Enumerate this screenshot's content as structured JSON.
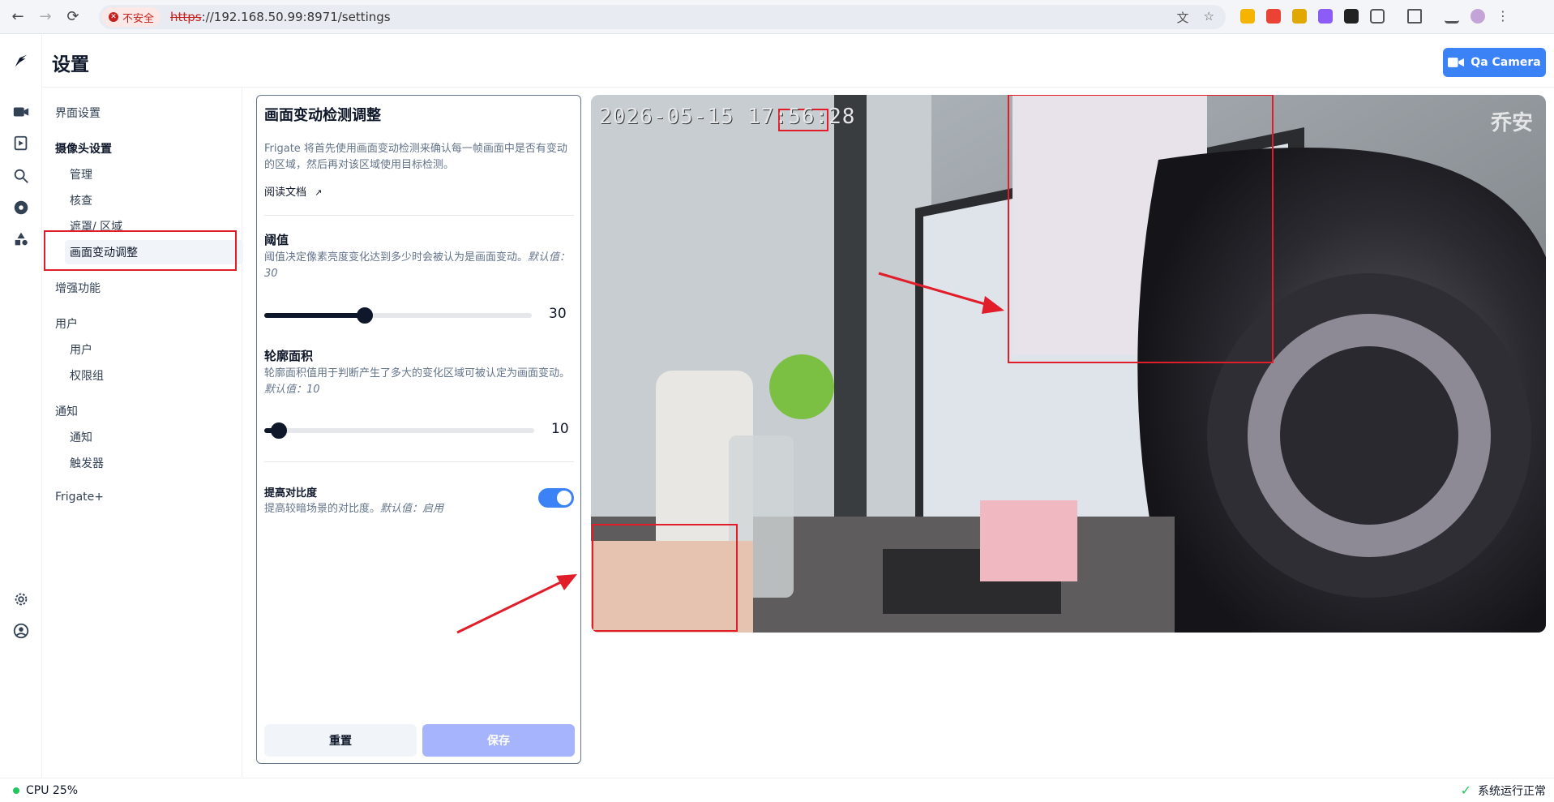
{
  "browser": {
    "insecure_label": "不安全",
    "url_scheme": "https",
    "url_rest": "://192.168.50.99:8971/settings"
  },
  "header": {
    "title": "设置",
    "camera_button": "Qa Camera"
  },
  "settings_nav": {
    "ui_settings": "界面设置",
    "camera_settings": "摄像头设置",
    "manage": "管理",
    "review": "核查",
    "masks_zones": "遮罩/ 区域",
    "motion_tuner": "画面变动调整",
    "enrichments": "增强功能",
    "users_section": "用户",
    "users": "用户",
    "roles": "权限组",
    "notifications_section": "通知",
    "notifications": "通知",
    "triggers": "触发器",
    "frigate_plus": "Frigate+"
  },
  "panel": {
    "title": "画面变动检测调整",
    "description": "Frigate 将首先使用画面变动检测来确认每一帧画面中是否有变动的区域，然后再对该区域使用目标检测。",
    "doc_link": "阅读文档",
    "threshold": {
      "title": "阈值",
      "description": "阈值决定像素亮度变化达到多少时会被认为是画面变动。",
      "default_text": "默认值：30",
      "value": 30,
      "min": 0,
      "max": 80
    },
    "contour_area": {
      "title": "轮廓面积",
      "description": "轮廓面积值用于判断产生了多大的变化区域可被认定为画面变动。",
      "default_text": "默认值：10",
      "value": 10,
      "min": 5,
      "max": 100
    },
    "improve_contrast": {
      "title": "提高对比度",
      "description": "提高较暗场景的对比度。",
      "default_text": "默认值：启用",
      "enabled": true
    },
    "reset_button": "重置",
    "save_button": "保存"
  },
  "camera": {
    "timestamp": "2026-05-15 17:56:28",
    "brand": "乔安"
  },
  "status": {
    "cpu": "CPU 25%",
    "system_status": "系统运行正常"
  },
  "colors": {
    "accent": "#3b82f6",
    "highlight": "#e11d2a",
    "ok": "#22c55e"
  }
}
